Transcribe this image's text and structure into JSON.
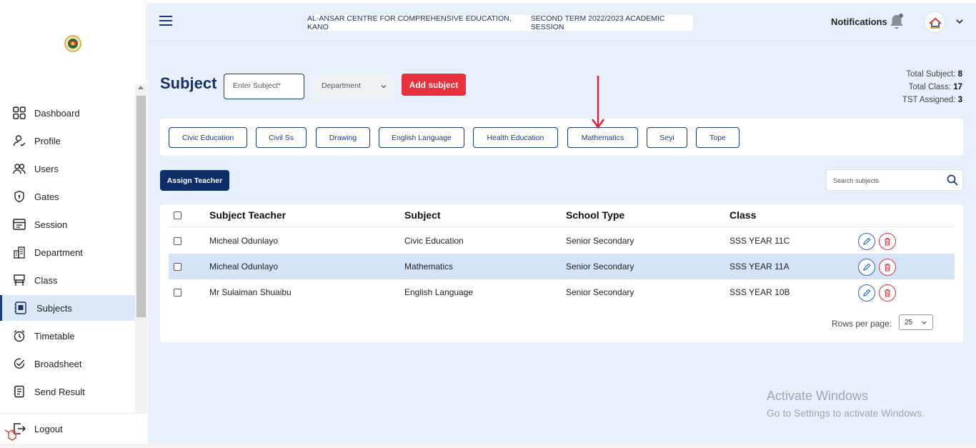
{
  "header": {
    "school_name": "AL-ANSAR CENTRE FOR COMPREHENSIVE EDUCATION, KANO",
    "session": "SECOND TERM 2022/2023 ACADEMIC SESSION",
    "notifications_label": "Notifications"
  },
  "sidebar": {
    "items": [
      {
        "label": "Dashboard",
        "icon": "dashboard-icon"
      },
      {
        "label": "Profile",
        "icon": "profile-icon"
      },
      {
        "label": "Users",
        "icon": "users-icon"
      },
      {
        "label": "Gates",
        "icon": "shield-icon"
      },
      {
        "label": "Session",
        "icon": "calendar-icon"
      },
      {
        "label": "Department",
        "icon": "building-icon"
      },
      {
        "label": "Class",
        "icon": "class-icon"
      },
      {
        "label": "Subjects",
        "icon": "subjects-icon"
      },
      {
        "label": "Timetable",
        "icon": "alarm-clock-icon"
      },
      {
        "label": "Broadsheet",
        "icon": "check-circle-icon"
      },
      {
        "label": "Send Result",
        "icon": "document-icon"
      }
    ],
    "active_index": 7,
    "logout_label": "Logout"
  },
  "page": {
    "title": "Subject",
    "subject_placeholder": "Enter Subject*",
    "department_placeholder": "Department",
    "add_button": "Add subject",
    "totals": {
      "subject_label": "Total Subject:",
      "subject_value": "8",
      "class_label": "Total Class:",
      "class_value": "17",
      "tst_label": "TST Assigned:",
      "tst_value": "3"
    }
  },
  "subject_chips": [
    "Civic Education",
    "Civil Ss",
    "Drawing",
    "English Language",
    "Health Education",
    "Mathematics",
    "Seyi",
    "Tope"
  ],
  "toolbar": {
    "assign_button": "Assign Teacher",
    "search_placeholder": "Search subjects"
  },
  "table": {
    "headers": [
      "Subject Teacher",
      "Subject",
      "School Type",
      "Class"
    ],
    "rows": [
      {
        "teacher": "Micheal Odunlayo",
        "subject": "Civic Education",
        "school_type": "Senior Secondary",
        "class": "SSS YEAR 11C"
      },
      {
        "teacher": "Micheal Odunlayo",
        "subject": "Mathematics",
        "school_type": "Senior Secondary",
        "class": "SSS YEAR 11A"
      },
      {
        "teacher": "Mr Sulaiman Shuaibu",
        "subject": "English Language",
        "school_type": "Senior Secondary",
        "class": "SSS YEAR 10B"
      }
    ],
    "selected_row": 1,
    "rows_per_page_label": "Rows per page:",
    "rows_per_page_value": "25"
  },
  "watermark": {
    "line1": "Activate Windows",
    "line2": "Go to Settings to activate Windows."
  },
  "colors": {
    "brand": "#1a3a7a",
    "accent_red": "#e8313c",
    "background": "#e7f0fb",
    "selected_row": "#d4e3f6"
  }
}
